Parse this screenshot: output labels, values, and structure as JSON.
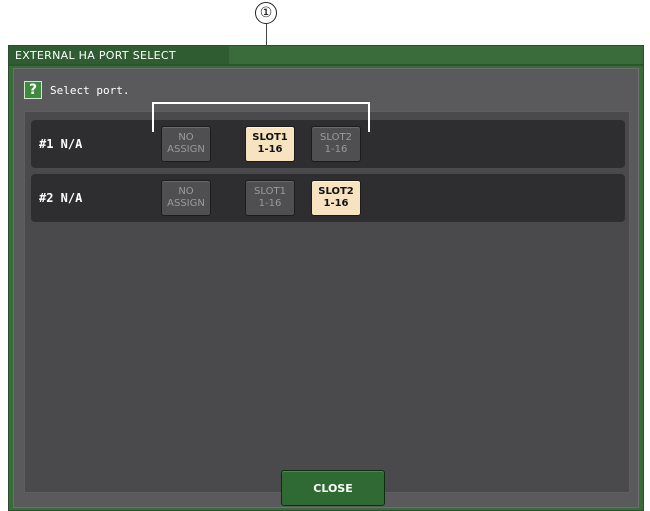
{
  "callout": {
    "number": "①"
  },
  "window": {
    "title": "EXTERNAL HA PORT SELECT"
  },
  "help": {
    "icon": "?",
    "text": "Select port."
  },
  "rows": [
    {
      "label": "#1  N/A",
      "buttons": [
        {
          "line1": "NO",
          "line2": "ASSIGN",
          "selected": false
        },
        {
          "line1": "SLOT1",
          "line2": "1-16",
          "selected": true
        },
        {
          "line1": "SLOT2",
          "line2": "1-16",
          "selected": false
        }
      ]
    },
    {
      "label": "#2  N/A",
      "buttons": [
        {
          "line1": "NO",
          "line2": "ASSIGN",
          "selected": false
        },
        {
          "line1": "SLOT1",
          "line2": "1-16",
          "selected": false
        },
        {
          "line1": "SLOT2",
          "line2": "1-16",
          "selected": true
        }
      ]
    }
  ],
  "footer": {
    "close_label": "CLOSE"
  },
  "colors": {
    "window_green": "#3a6b3b",
    "selected_button": "#f7e3bf",
    "unselected_button": "#4f4f51",
    "panel_gray": "#4a4a4c"
  }
}
